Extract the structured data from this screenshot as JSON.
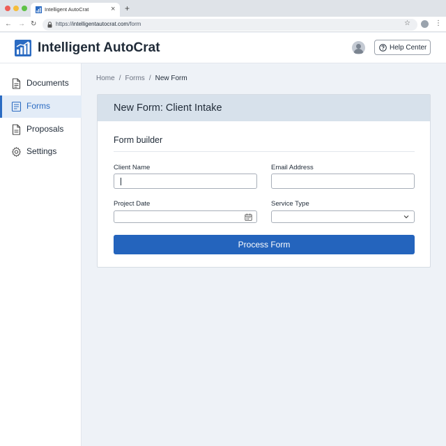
{
  "browser": {
    "tab_title": "Intelligent AutoCrat",
    "tab_close": "×",
    "new_tab": "+",
    "url_prefix": "https://",
    "url_host": "intelligentautocrat.com",
    "url_path": "/form"
  },
  "header": {
    "app_title": "Intelligent AutoCrat",
    "help_label": "Help Center"
  },
  "sidebar": {
    "items": [
      {
        "label": "Documents",
        "icon": "document-icon",
        "active": false
      },
      {
        "label": "Forms",
        "icon": "form-icon",
        "active": true
      },
      {
        "label": "Proposals",
        "icon": "proposal-icon",
        "active": false
      },
      {
        "label": "Settings",
        "icon": "gear-icon",
        "active": false
      }
    ]
  },
  "breadcrumb": {
    "items": [
      "Home",
      "Forms",
      "New Form"
    ],
    "separator": "/"
  },
  "form": {
    "card_title": "New Form: Client Intake",
    "section_title": "Form builder",
    "fields": {
      "client_name": {
        "label": "Client Name",
        "value": ""
      },
      "email": {
        "label": "Email Address",
        "value": ""
      },
      "project_date": {
        "label": "Project Date",
        "value": ""
      },
      "service_type": {
        "label": "Service Type",
        "value": ""
      }
    },
    "submit_label": "Process Form"
  },
  "colors": {
    "accent": "#2464bd",
    "card_header": "#d7e1eb",
    "page_bg": "#eef2f7"
  }
}
